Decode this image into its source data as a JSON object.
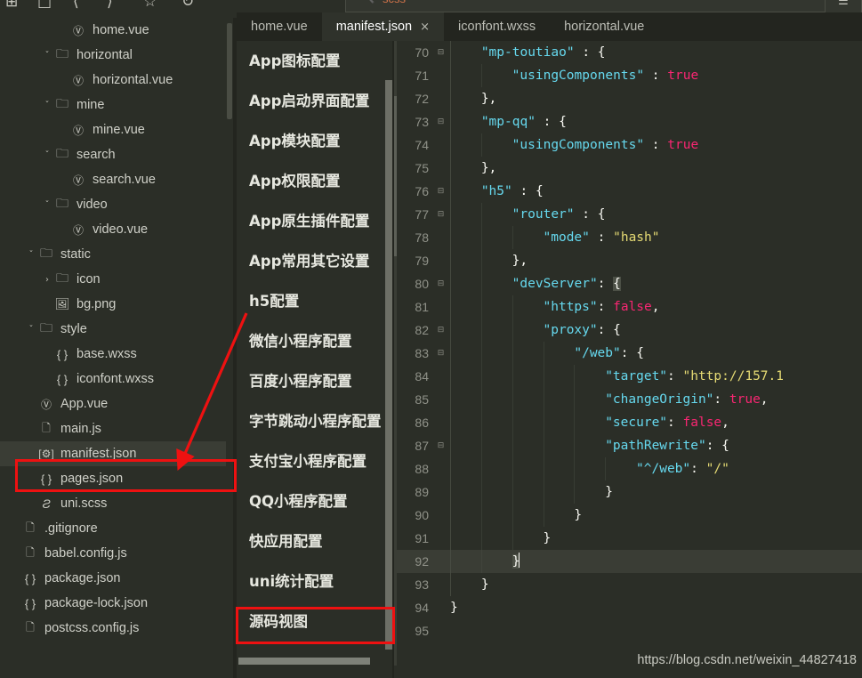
{
  "toolbar": {
    "icons": [
      "new-file-icon",
      "stop-icon",
      "back-icon",
      "forward-icon",
      "bookmark-icon",
      "undo-icon"
    ],
    "search_text": "scss",
    "search_icon": "search-icon",
    "right_icon": "more-icon"
  },
  "explorer": {
    "items": [
      {
        "indent": 3,
        "twisty": "",
        "icon": "vue-file-icon",
        "label": "home.vue"
      },
      {
        "indent": 2,
        "twisty": "v",
        "icon": "folder-icon",
        "label": "horizontal"
      },
      {
        "indent": 3,
        "twisty": "",
        "icon": "vue-file-icon",
        "label": "horizontal.vue"
      },
      {
        "indent": 2,
        "twisty": "v",
        "icon": "folder-icon",
        "label": "mine"
      },
      {
        "indent": 3,
        "twisty": "",
        "icon": "vue-file-icon",
        "label": "mine.vue"
      },
      {
        "indent": 2,
        "twisty": "v",
        "icon": "folder-icon",
        "label": "search"
      },
      {
        "indent": 3,
        "twisty": "",
        "icon": "vue-file-icon",
        "label": "search.vue"
      },
      {
        "indent": 2,
        "twisty": "v",
        "icon": "folder-icon",
        "label": "video"
      },
      {
        "indent": 3,
        "twisty": "",
        "icon": "vue-file-icon",
        "label": "video.vue"
      },
      {
        "indent": 1,
        "twisty": "v",
        "icon": "folder-icon",
        "label": "static"
      },
      {
        "indent": 2,
        "twisty": ">",
        "icon": "folder-icon",
        "label": "icon"
      },
      {
        "indent": 2,
        "twisty": "",
        "icon": "image-file-icon",
        "label": "bg.png"
      },
      {
        "indent": 1,
        "twisty": "v",
        "icon": "folder-icon",
        "label": "style"
      },
      {
        "indent": 2,
        "twisty": "",
        "icon": "json-file-icon",
        "label": "base.wxss"
      },
      {
        "indent": 2,
        "twisty": "",
        "icon": "json-file-icon",
        "label": "iconfont.wxss"
      },
      {
        "indent": 1,
        "twisty": "",
        "icon": "vue-file-icon",
        "label": "App.vue"
      },
      {
        "indent": 1,
        "twisty": "",
        "icon": "js-file-icon",
        "label": "main.js"
      },
      {
        "indent": 1,
        "twisty": "",
        "icon": "gear-file-icon",
        "label": "manifest.json",
        "selected": true
      },
      {
        "indent": 1,
        "twisty": "",
        "icon": "json-file-icon",
        "label": "pages.json"
      },
      {
        "indent": 1,
        "twisty": "",
        "icon": "scss-file-icon",
        "label": "uni.scss"
      },
      {
        "indent": 0,
        "twisty": "",
        "icon": "plain-file-icon",
        "label": ".gitignore"
      },
      {
        "indent": 0,
        "twisty": "",
        "icon": "js-file-icon",
        "label": "babel.config.js"
      },
      {
        "indent": 0,
        "twisty": "",
        "icon": "json-file-icon",
        "label": "package.json"
      },
      {
        "indent": 0,
        "twisty": "",
        "icon": "json-file-icon",
        "label": "package-lock.json"
      },
      {
        "indent": 0,
        "twisty": "",
        "icon": "js-file-icon",
        "label": "postcss.config.js"
      }
    ]
  },
  "config_panel": {
    "items": [
      {
        "label": "App图标配置"
      },
      {
        "label": "App启动界面配置"
      },
      {
        "label": "App模块配置"
      },
      {
        "label": "App权限配置"
      },
      {
        "label": "App原生插件配置"
      },
      {
        "label": "App常用其它设置"
      },
      {
        "label": "h5配置"
      },
      {
        "label": "微信小程序配置"
      },
      {
        "label": "百度小程序配置"
      },
      {
        "label": "字节跳动小程序配置"
      },
      {
        "label": "支付宝小程序配置"
      },
      {
        "label": "QQ小程序配置"
      },
      {
        "label": "快应用配置"
      },
      {
        "label": "uni统计配置"
      },
      {
        "label": "源码视图",
        "highlighted": true
      }
    ]
  },
  "tabs": [
    {
      "label": "home.vue",
      "active": false,
      "closable": false
    },
    {
      "label": "manifest.json",
      "active": true,
      "closable": true,
      "close_label": "×"
    },
    {
      "label": "iconfont.wxss",
      "active": false,
      "closable": false
    },
    {
      "label": "horizontal.vue",
      "active": false,
      "closable": false
    }
  ],
  "editor": {
    "lines": [
      {
        "no": "70",
        "fold": "⊟",
        "indent": 1,
        "current": false,
        "tokens": [
          {
            "t": "\"mp-toutiao\"",
            "c": "k"
          },
          {
            "t": " : ",
            "c": "p"
          },
          {
            "t": "{",
            "c": "p"
          }
        ]
      },
      {
        "no": "71",
        "fold": "",
        "indent": 2,
        "current": false,
        "tokens": [
          {
            "t": "\"usingComponents\"",
            "c": "k"
          },
          {
            "t": " : ",
            "c": "p"
          },
          {
            "t": "true",
            "c": "b"
          }
        ]
      },
      {
        "no": "72",
        "fold": "",
        "indent": 1,
        "current": false,
        "tokens": [
          {
            "t": "},",
            "c": "p"
          }
        ]
      },
      {
        "no": "73",
        "fold": "⊟",
        "indent": 1,
        "current": false,
        "tokens": [
          {
            "t": "\"mp-qq\"",
            "c": "k"
          },
          {
            "t": " : ",
            "c": "p"
          },
          {
            "t": "{",
            "c": "p"
          }
        ]
      },
      {
        "no": "74",
        "fold": "",
        "indent": 2,
        "current": false,
        "tokens": [
          {
            "t": "\"usingComponents\"",
            "c": "k"
          },
          {
            "t": " : ",
            "c": "p"
          },
          {
            "t": "true",
            "c": "b"
          }
        ]
      },
      {
        "no": "75",
        "fold": "",
        "indent": 1,
        "current": false,
        "tokens": [
          {
            "t": "},",
            "c": "p"
          }
        ]
      },
      {
        "no": "76",
        "fold": "⊟",
        "indent": 1,
        "current": false,
        "tokens": [
          {
            "t": "\"h5\"",
            "c": "k"
          },
          {
            "t": " : ",
            "c": "p"
          },
          {
            "t": "{",
            "c": "p"
          }
        ]
      },
      {
        "no": "77",
        "fold": "⊟",
        "indent": 2,
        "current": false,
        "tokens": [
          {
            "t": "\"router\"",
            "c": "k"
          },
          {
            "t": " : ",
            "c": "p"
          },
          {
            "t": "{",
            "c": "p"
          }
        ]
      },
      {
        "no": "78",
        "fold": "",
        "indent": 3,
        "current": false,
        "tokens": [
          {
            "t": "\"mode\"",
            "c": "k"
          },
          {
            "t": " : ",
            "c": "p"
          },
          {
            "t": "\"hash\"",
            "c": "s"
          }
        ]
      },
      {
        "no": "79",
        "fold": "",
        "indent": 2,
        "current": false,
        "tokens": [
          {
            "t": "},",
            "c": "p"
          }
        ]
      },
      {
        "no": "80",
        "fold": "⊟",
        "indent": 2,
        "current": false,
        "tokens": [
          {
            "t": "\"devServer\"",
            "c": "k"
          },
          {
            "t": ": ",
            "c": "p"
          },
          {
            "t": "{",
            "c": "p",
            "sel": true
          }
        ]
      },
      {
        "no": "81",
        "fold": "",
        "indent": 3,
        "current": false,
        "tokens": [
          {
            "t": "\"https\"",
            "c": "k"
          },
          {
            "t": ": ",
            "c": "p"
          },
          {
            "t": "false",
            "c": "b"
          },
          {
            "t": ",",
            "c": "p"
          }
        ]
      },
      {
        "no": "82",
        "fold": "⊟",
        "indent": 3,
        "current": false,
        "tokens": [
          {
            "t": "\"proxy\"",
            "c": "k"
          },
          {
            "t": ": ",
            "c": "p"
          },
          {
            "t": "{",
            "c": "p"
          }
        ]
      },
      {
        "no": "83",
        "fold": "⊟",
        "indent": 4,
        "current": false,
        "tokens": [
          {
            "t": "\"/web\"",
            "c": "k"
          },
          {
            "t": ": ",
            "c": "p"
          },
          {
            "t": "{",
            "c": "p"
          }
        ]
      },
      {
        "no": "84",
        "fold": "",
        "indent": 5,
        "current": false,
        "tokens": [
          {
            "t": "\"target\"",
            "c": "k"
          },
          {
            "t": ": ",
            "c": "p"
          },
          {
            "t": "\"http://157.1",
            "c": "s"
          }
        ]
      },
      {
        "no": "85",
        "fold": "",
        "indent": 5,
        "current": false,
        "tokens": [
          {
            "t": "\"changeOrigin\"",
            "c": "k"
          },
          {
            "t": ": ",
            "c": "p"
          },
          {
            "t": "true",
            "c": "b"
          },
          {
            "t": ",",
            "c": "p"
          }
        ]
      },
      {
        "no": "86",
        "fold": "",
        "indent": 5,
        "current": false,
        "tokens": [
          {
            "t": "\"secure\"",
            "c": "k"
          },
          {
            "t": ": ",
            "c": "p"
          },
          {
            "t": "false",
            "c": "b"
          },
          {
            "t": ",",
            "c": "p"
          }
        ]
      },
      {
        "no": "87",
        "fold": "⊟",
        "indent": 5,
        "current": false,
        "tokens": [
          {
            "t": "\"pathRewrite\"",
            "c": "k"
          },
          {
            "t": ": ",
            "c": "p"
          },
          {
            "t": "{",
            "c": "p"
          }
        ]
      },
      {
        "no": "88",
        "fold": "",
        "indent": 6,
        "current": false,
        "tokens": [
          {
            "t": "\"^/web\"",
            "c": "k"
          },
          {
            "t": ": ",
            "c": "p"
          },
          {
            "t": "\"/\"",
            "c": "s"
          }
        ]
      },
      {
        "no": "89",
        "fold": "",
        "indent": 5,
        "current": false,
        "tokens": [
          {
            "t": "}",
            "c": "p"
          }
        ]
      },
      {
        "no": "90",
        "fold": "",
        "indent": 4,
        "current": false,
        "tokens": [
          {
            "t": "}",
            "c": "p"
          }
        ]
      },
      {
        "no": "91",
        "fold": "",
        "indent": 3,
        "current": false,
        "tokens": [
          {
            "t": "}",
            "c": "p"
          }
        ]
      },
      {
        "no": "92",
        "fold": "",
        "indent": 2,
        "current": true,
        "tokens": [
          {
            "t": "}",
            "c": "p",
            "sel": true
          },
          {
            "t": "",
            "c": "cursor"
          }
        ]
      },
      {
        "no": "93",
        "fold": "",
        "indent": 1,
        "current": false,
        "tokens": [
          {
            "t": "}",
            "c": "p"
          }
        ]
      },
      {
        "no": "94",
        "fold": "",
        "indent": 0,
        "current": false,
        "tokens": [
          {
            "t": "}",
            "c": "p"
          }
        ]
      },
      {
        "no": "95",
        "fold": "",
        "indent": 0,
        "current": false,
        "tokens": []
      }
    ]
  },
  "watermark": "https://blog.csdn.net/weixin_44827418",
  "annotations": {
    "colors": {
      "red": "#ee1111"
    },
    "manifest_box": "manifest.json highlight box",
    "source_view_box": "源码视图 highlight box",
    "arrow": "arrow pointing to manifest.json"
  }
}
